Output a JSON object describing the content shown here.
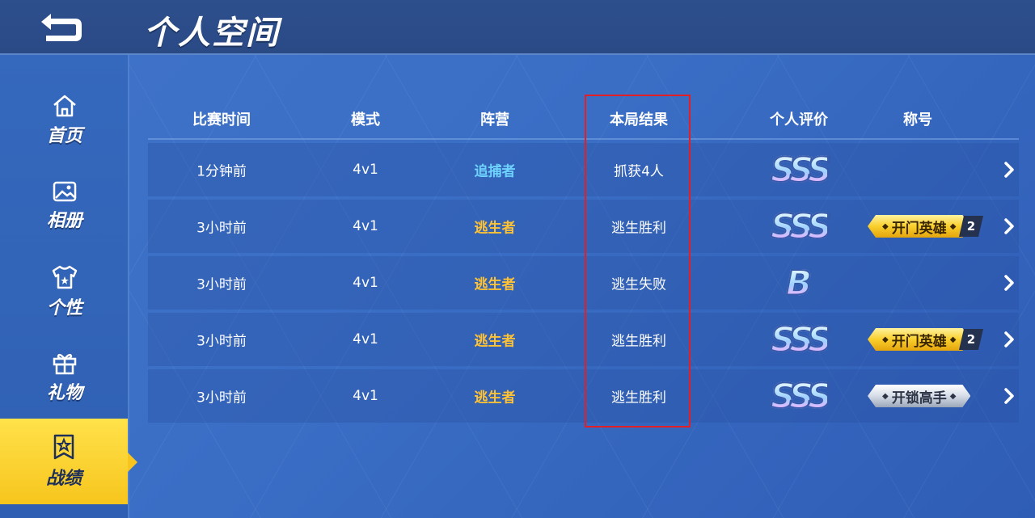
{
  "header": {
    "title": "个人空间",
    "back_icon": "back-arrow-icon"
  },
  "sidebar": {
    "items": [
      {
        "label": "首页",
        "icon": "home-icon",
        "active": false
      },
      {
        "label": "相册",
        "icon": "image-icon",
        "active": false
      },
      {
        "label": "个性",
        "icon": "tshirt-icon",
        "active": false
      },
      {
        "label": "礼物",
        "icon": "gift-icon",
        "active": false
      },
      {
        "label": "战绩",
        "icon": "medal-star-icon",
        "active": true
      }
    ]
  },
  "table": {
    "headers": {
      "time": "比赛时间",
      "mode": "模式",
      "camp": "阵营",
      "result": "本局结果",
      "rating": "个人评价",
      "title": "称号"
    },
    "rows": [
      {
        "time": "1分钟前",
        "mode": "4v1",
        "camp": "追捕者",
        "result": "抓获4人",
        "rating": "SSS",
        "title": "",
        "title_count": ""
      },
      {
        "time": "3小时前",
        "mode": "4v1",
        "camp": "逃生者",
        "result": "逃生胜利",
        "rating": "SSS",
        "title": "开门英雄",
        "title_count": "2"
      },
      {
        "time": "3小时前",
        "mode": "4v1",
        "camp": "逃生者",
        "result": "逃生失败",
        "rating": "B",
        "title": "",
        "title_count": ""
      },
      {
        "time": "3小时前",
        "mode": "4v1",
        "camp": "逃生者",
        "result": "逃生胜利",
        "rating": "SSS",
        "title": "开门英雄",
        "title_count": "2"
      },
      {
        "time": "3小时前",
        "mode": "4v1",
        "camp": "逃生者",
        "result": "逃生胜利",
        "rating": "SSS",
        "title": "开锁高手",
        "title_count": ""
      }
    ]
  },
  "colors": {
    "hunter": "#6fd3ff",
    "escapee": "#ffc233",
    "active_nav": "#f7c51d",
    "highlight_box": "#e31e24"
  }
}
